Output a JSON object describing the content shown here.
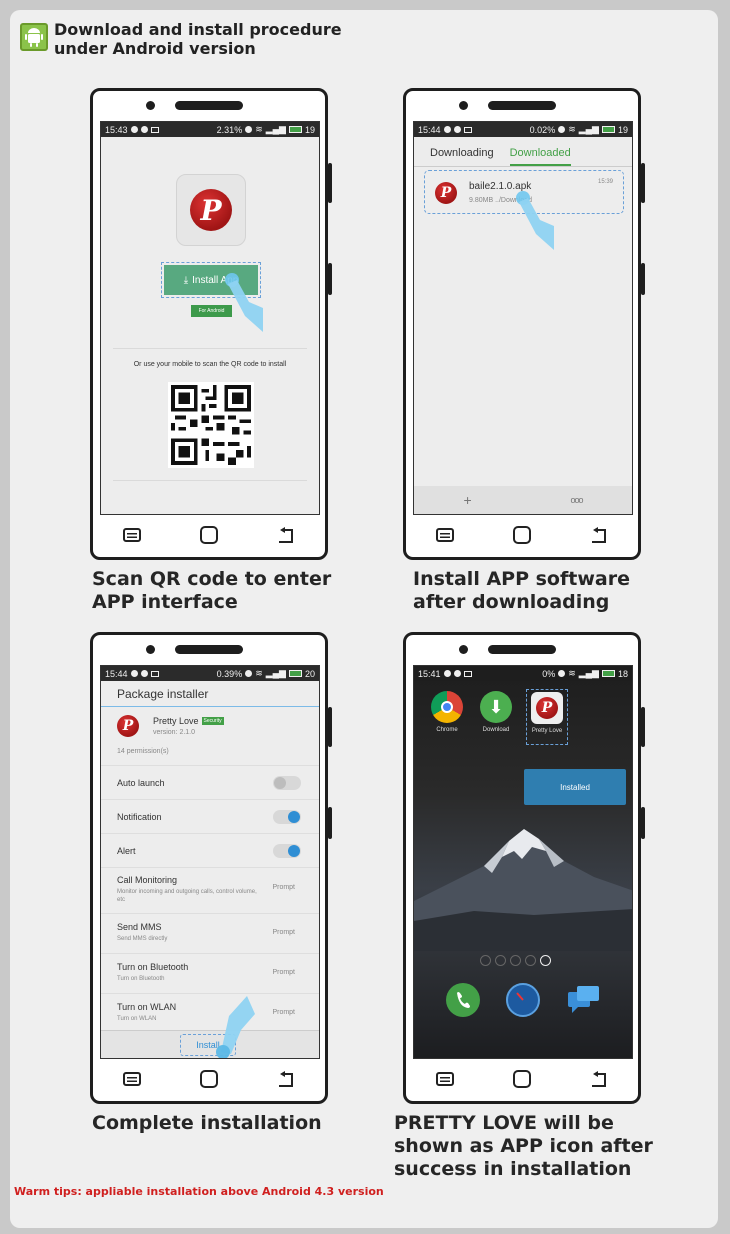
{
  "header": {
    "title": "Download and install procedure under Android version"
  },
  "captions": {
    "step1": "Scan QR code to enter APP interface",
    "step2": "Install APP software after downloading",
    "step3": "Complete installation",
    "step4": "PRETTY LOVE will be shown as APP icon after success in installation"
  },
  "tips": "Warm tips: appliable installation above Android 4.3 version",
  "screen1": {
    "status_time": "15:43",
    "status_pct": "2.31%",
    "status_battery": "19",
    "install_label": "Install App",
    "for_android": "For Android",
    "qr_text": "Or use your mobile to scan the QR code to install"
  },
  "screen2": {
    "status_time": "15:44",
    "status_pct": "0.02%",
    "status_battery": "19",
    "tab_downloading": "Downloading",
    "tab_downloaded": "Downloaded",
    "file_name": "baile2.1.0.apk",
    "file_meta": "9.80MB  ../Download",
    "file_time": "15:39",
    "add_label": "+",
    "more_label": "ooo"
  },
  "screen3": {
    "status_time": "15:44",
    "status_pct": "0.39%",
    "status_battery": "20",
    "title": "Package installer",
    "app_name": "Pretty Love",
    "security_badge": "Security",
    "version": "version: 2.1.0",
    "permissions": "14 permission(s)",
    "rows": {
      "auto_launch": "Auto launch",
      "notification": "Notification",
      "alert": "Alert",
      "call_monitoring": "Call Monitoring",
      "call_monitoring_sub": "Monitor incoming and outgoing calls, control volume, etc",
      "send_mms": "Send MMS",
      "send_mms_sub": "Send MMS directly",
      "bluetooth": "Turn on Bluetooth",
      "bluetooth_sub": "Turn on Bluetooth",
      "wlan": "Turn on WLAN",
      "wlan_sub": "Turn on WLAN",
      "prompt": "Prompt"
    },
    "install_label": "Install"
  },
  "screen4": {
    "status_time": "15:41",
    "status_pct": "0%",
    "status_battery": "18",
    "chrome": "Chrome",
    "download": "Download",
    "pretty_love": "Pretty Love",
    "installed_popup": "Installed"
  },
  "colors": {
    "accent_green": "#43a047",
    "install_green": "#58a980",
    "tips_red": "#d0201f",
    "select_blue": "#2f8ed4"
  }
}
